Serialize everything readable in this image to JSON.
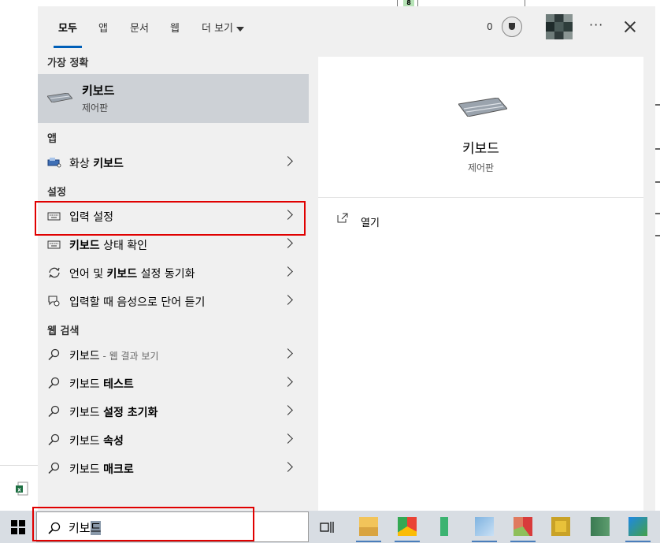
{
  "background": {
    "badge": "8"
  },
  "topbar": {
    "tabs": [
      {
        "label": "모두",
        "active": true
      },
      {
        "label": "앱"
      },
      {
        "label": "문서"
      },
      {
        "label": "웹"
      }
    ],
    "more_label": "더 보기",
    "points": "0",
    "icons": [
      "trophy-icon",
      "avatar",
      "more-options-icon",
      "close-icon"
    ]
  },
  "sections": {
    "best_match": "가장 정확",
    "apps": "앱",
    "settings": "설정",
    "web_search": "웹 검색"
  },
  "best_match": {
    "title": "키보드",
    "subtitle": "제어판"
  },
  "apps": [
    {
      "pre": "화상 ",
      "bold": "키보드",
      "post": "",
      "icon": "on-screen-keyboard-icon"
    }
  ],
  "settings": [
    {
      "pre": "입력 설정",
      "bold": "",
      "post": "",
      "icon": "keyboard-icon"
    },
    {
      "pre": "",
      "bold": "키보드",
      "post": " 상태 확인",
      "icon": "keyboard-icon"
    },
    {
      "pre": "언어 및 ",
      "bold": "키보드",
      "post": " 설정 동기화",
      "icon": "sync-icon"
    },
    {
      "pre": "입력할 때 음성으로 단어 듣기",
      "bold": "",
      "post": "",
      "icon": "speech-icon"
    }
  ],
  "web_search": [
    {
      "pre": "키보드",
      "bold": "",
      "post": "",
      "hint": " - 웹 결과 보기",
      "icon": "search-icon"
    },
    {
      "pre": "키보드 ",
      "bold": "테스트",
      "post": "",
      "icon": "search-icon"
    },
    {
      "pre": "키보드 ",
      "bold": "설정 초기화",
      "post": "",
      "icon": "search-icon"
    },
    {
      "pre": "키보드 ",
      "bold": "속성",
      "post": "",
      "icon": "search-icon"
    },
    {
      "pre": "키보드 ",
      "bold": "매크로",
      "post": "",
      "icon": "search-icon"
    }
  ],
  "preview": {
    "title": "키보드",
    "subtitle": "제어판",
    "open_label": "열기"
  },
  "search": {
    "typed": "키보",
    "selected": "드"
  },
  "colors": {
    "accent": "#005fb8",
    "highlight_box": "#e00000",
    "selected_row": "#cdd1d6",
    "panel_bg": "#f0f0f0",
    "taskbar_bg": "#d8dde3"
  }
}
